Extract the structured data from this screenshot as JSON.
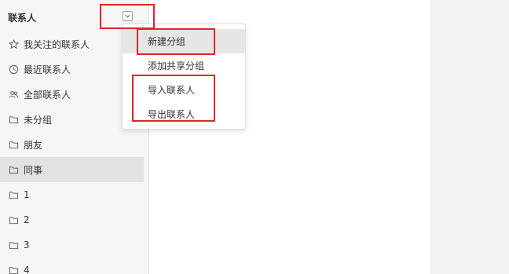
{
  "sidebar": {
    "title": "联系人",
    "items": [
      {
        "label": "我关注的联系人",
        "icon": "star-icon"
      },
      {
        "label": "最近联系人",
        "icon": "clock-icon"
      },
      {
        "label": "全部联系人",
        "icon": "people-icon"
      },
      {
        "label": "未分组",
        "icon": "folder-icon"
      },
      {
        "label": "朋友",
        "icon": "folder-icon"
      },
      {
        "label": "同事",
        "icon": "folder-icon",
        "active": true
      },
      {
        "label": "1",
        "icon": "folder-icon"
      },
      {
        "label": "2",
        "icon": "folder-icon"
      },
      {
        "label": "3",
        "icon": "folder-icon"
      },
      {
        "label": "4",
        "icon": "folder-icon"
      }
    ]
  },
  "dropdown": {
    "items": [
      {
        "label": "新建分组",
        "highlighted": true
      },
      {
        "label": "添加共享分组"
      },
      {
        "label": "导入联系人"
      },
      {
        "label": "导出联系人"
      }
    ]
  },
  "colors": {
    "annotation_red": "#e0262b",
    "sidebar_bg": "#f6f6f6",
    "active_item_bg": "#e2e2e2"
  }
}
